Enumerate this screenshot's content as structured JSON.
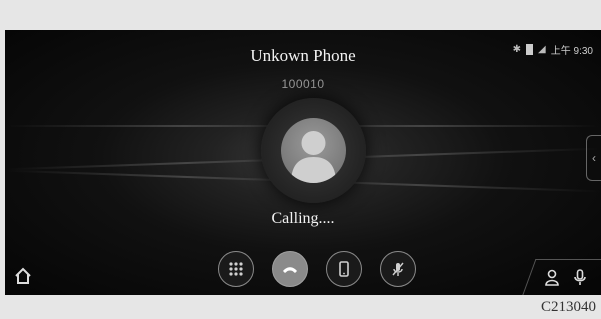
{
  "call": {
    "caller_name": "Unkown  Phone",
    "caller_number": "100010",
    "status_text": "Calling...."
  },
  "status_bar": {
    "time": "上午 9:30",
    "icons": [
      "bluetooth-icon",
      "battery-icon",
      "signal-icon"
    ]
  },
  "controls": [
    {
      "name": "keypad-button",
      "icon": "keypad-icon"
    },
    {
      "name": "end-call-button",
      "icon": "hang-up-icon"
    },
    {
      "name": "handset-button",
      "icon": "phone-handset-icon"
    },
    {
      "name": "mute-button",
      "icon": "mic-off-icon"
    }
  ],
  "bottom_right": [
    "contacts-icon",
    "microphone-icon"
  ],
  "figure_code": "C213040"
}
